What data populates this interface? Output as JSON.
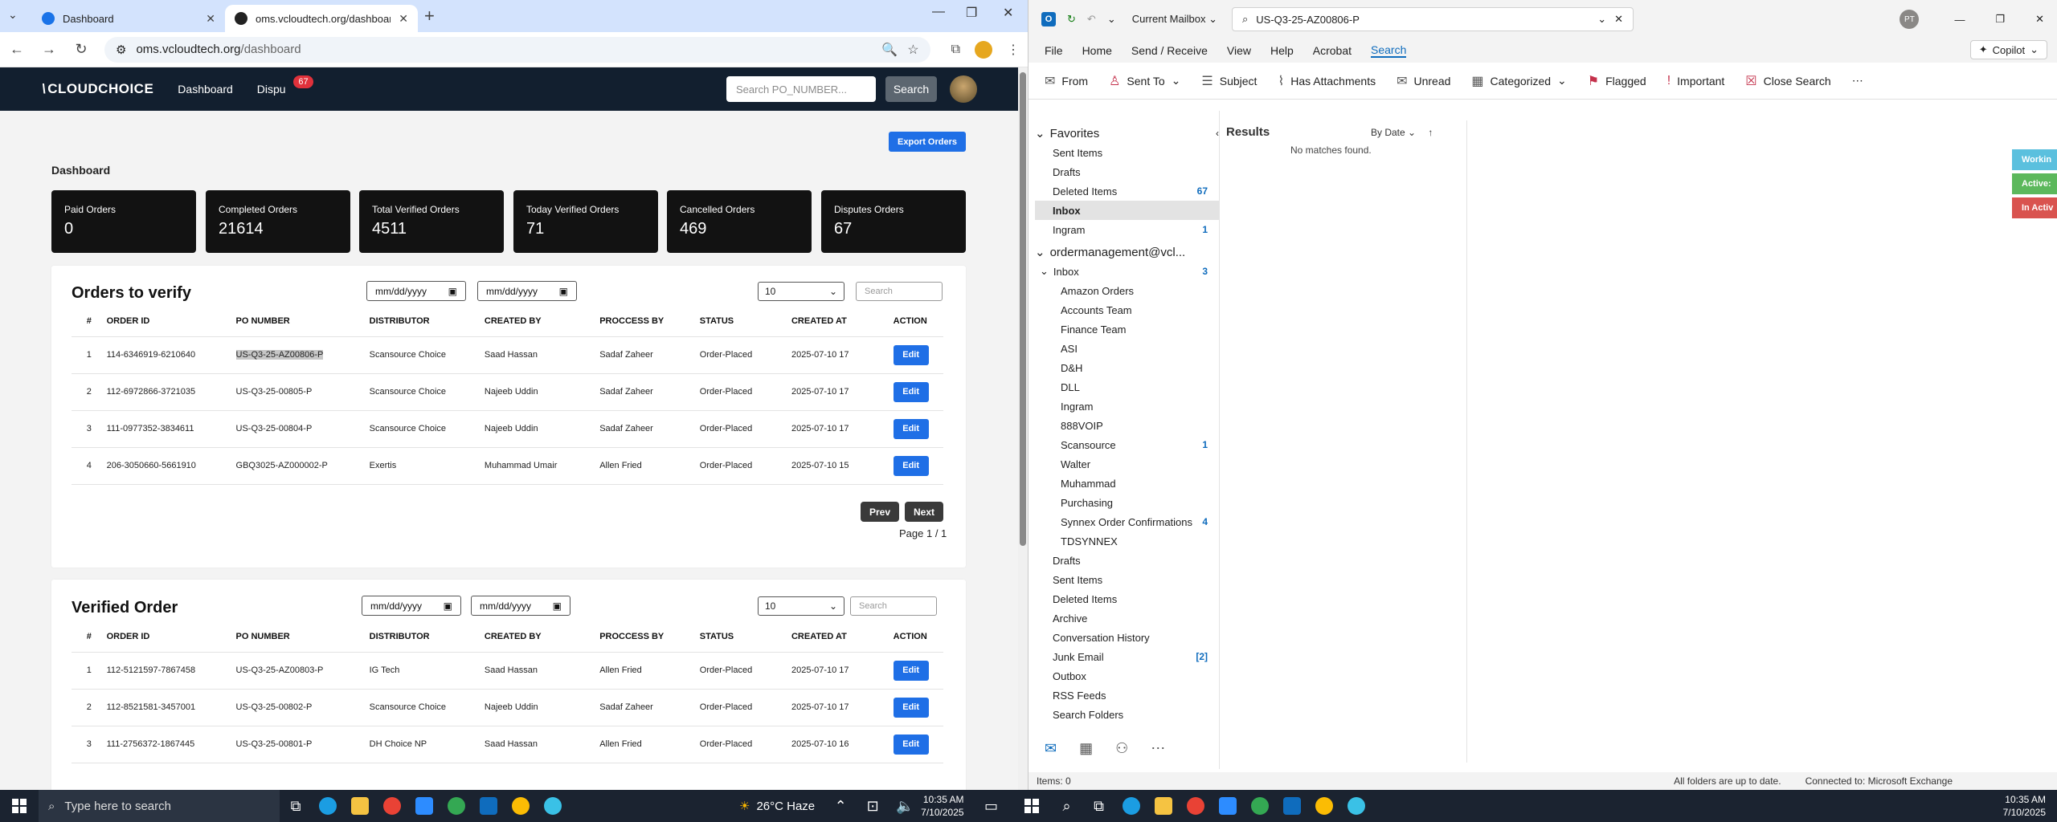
{
  "left_browser": {
    "tab_list_icon": "chevron-down-icon",
    "tabs": [
      {
        "title": "Dashboard",
        "active": false
      },
      {
        "title": "oms.vcloudtech.org/dashboard",
        "active": true
      }
    ],
    "address": {
      "host": "oms.vcloudtech.org",
      "path": "/dashboard"
    }
  },
  "app": {
    "logo_text": "CLOUDCHOICE",
    "nav": {
      "dashboard": "Dashboard",
      "disputes": "Dispu",
      "disputes_badge": "67"
    },
    "search_placeholder": "Search PO_NUMBER...",
    "search_button": "Search",
    "export_button": "Export Orders",
    "page_title": "Dashboard",
    "stats": [
      {
        "label": "Paid Orders",
        "value": "0"
      },
      {
        "label": "Completed Orders",
        "value": "21614"
      },
      {
        "label": "Total Verified Orders",
        "value": "4511"
      },
      {
        "label": "Today Verified Orders",
        "value": "71"
      },
      {
        "label": "Cancelled Orders",
        "value": "469"
      },
      {
        "label": "Disputes Orders",
        "value": "67"
      }
    ],
    "date_placeholder": "mm/dd/yyyy",
    "page_size": "10",
    "table_search_placeholder": "Search",
    "columns": [
      "#",
      "ORDER ID",
      "PO NUMBER",
      "DISTRIBUTOR",
      "CREATED BY",
      "PROCCESS BY",
      "STATUS",
      "CREATED AT",
      "ACTION"
    ],
    "edit_label": "Edit",
    "orders_to_verify": {
      "title": "Orders to verify",
      "rows": [
        [
          "1",
          "114-6346919-6210640",
          "US-Q3-25-AZ00806-P",
          "Scansource Choice",
          "Saad Hassan",
          "Sadaf Zaheer",
          "Order-Placed",
          "2025-07-10 17"
        ],
        [
          "2",
          "112-6972866-3721035",
          "US-Q3-25-00805-P",
          "Scansource Choice",
          "Najeeb Uddin",
          "Sadaf Zaheer",
          "Order-Placed",
          "2025-07-10 17"
        ],
        [
          "3",
          "111-0977352-3834611",
          "US-Q3-25-00804-P",
          "Scansource Choice",
          "Najeeb Uddin",
          "Sadaf Zaheer",
          "Order-Placed",
          "2025-07-10 17"
        ],
        [
          "4",
          "206-3050660-5661910",
          "GBQ3025-AZ000002-P",
          "Exertis",
          "Muhammad Umair",
          "Allen Fried",
          "Order-Placed",
          "2025-07-10 15"
        ]
      ],
      "prev": "Prev",
      "next": "Next",
      "page_info": "Page 1 / 1"
    },
    "verified_order": {
      "title": "Verified Order",
      "rows": [
        [
          "1",
          "112-5121597-7867458",
          "US-Q3-25-AZ00803-P",
          "IG Tech",
          "Saad Hassan",
          "Allen Fried",
          "Order-Placed",
          "2025-07-10 17"
        ],
        [
          "2",
          "112-8521581-3457001",
          "US-Q3-25-00802-P",
          "Scansource Choice",
          "Najeeb Uddin",
          "Sadaf Zaheer",
          "Order-Placed",
          "2025-07-10 17"
        ],
        [
          "3",
          "111-2756372-1867445",
          "US-Q3-25-00801-P",
          "DH Choice NP",
          "Saad Hassan",
          "Allen Fried",
          "Order-Placed",
          "2025-07-10 16"
        ]
      ]
    }
  },
  "outlook": {
    "scope": "Current Mailbox",
    "search_query": "US-Q3-25-AZ00806-P",
    "user_initials": "PT",
    "menu": [
      "File",
      "Home",
      "Send / Receive",
      "View",
      "Help",
      "Acrobat",
      "Search"
    ],
    "copilot": "Copilot",
    "ribbon": [
      {
        "label": "From",
        "icon": "envelope-icon"
      },
      {
        "label": "Sent To",
        "icon": "person-icon"
      },
      {
        "label": "Subject",
        "icon": "list-icon"
      },
      {
        "label": "Has Attachments",
        "icon": "paperclip-icon"
      },
      {
        "label": "Unread",
        "icon": "open-envelope-icon"
      },
      {
        "label": "Categorized",
        "icon": "category-icon"
      },
      {
        "label": "Flagged",
        "icon": "flag-icon"
      },
      {
        "label": "Important",
        "icon": "exclamation-icon"
      },
      {
        "label": "Close Search",
        "icon": "close-icon"
      }
    ],
    "favorites_label": "Favorites",
    "favorites": [
      {
        "name": "Sent Items",
        "count": ""
      },
      {
        "name": "Drafts",
        "count": ""
      },
      {
        "name": "Deleted Items",
        "count": "67"
      },
      {
        "name": "Inbox",
        "count": ""
      },
      {
        "name": "Ingram",
        "count": "1"
      }
    ],
    "account": "ordermanagement@vcl...",
    "inbox_label": "Inbox",
    "inbox_count": "3",
    "subfolders": [
      {
        "name": "Amazon Orders",
        "count": ""
      },
      {
        "name": "Accounts Team",
        "count": ""
      },
      {
        "name": "Finance Team",
        "count": ""
      },
      {
        "name": "ASI",
        "count": ""
      },
      {
        "name": "D&H",
        "count": ""
      },
      {
        "name": "DLL",
        "count": ""
      },
      {
        "name": "Ingram",
        "count": ""
      },
      {
        "name": "888VOIP",
        "count": ""
      },
      {
        "name": "Scansource",
        "count": "1"
      },
      {
        "name": "Walter",
        "count": ""
      },
      {
        "name": "Muhammad",
        "count": ""
      },
      {
        "name": "Purchasing",
        "count": ""
      },
      {
        "name": "Synnex Order Confirmations",
        "count": "4"
      },
      {
        "name": "TDSYNNEX",
        "count": ""
      }
    ],
    "other_folders": [
      {
        "name": "Drafts",
        "count": ""
      },
      {
        "name": "Sent Items",
        "count": ""
      },
      {
        "name": "Deleted Items",
        "count": ""
      },
      {
        "name": "Archive",
        "count": ""
      },
      {
        "name": "Conversation History",
        "count": ""
      },
      {
        "name": "Junk Email",
        "count": "[2]"
      },
      {
        "name": "Outbox",
        "count": ""
      },
      {
        "name": "RSS Feeds",
        "count": ""
      },
      {
        "name": "Search Folders",
        "count": ""
      }
    ],
    "results_title": "Results",
    "sort": "By Date",
    "no_matches": "No matches found.",
    "side_tags": [
      {
        "label": "Workin",
        "color": "#5bc0de"
      },
      {
        "label": "Active:",
        "color": "#5cb85c"
      },
      {
        "label": "In Activ",
        "color": "#d9534f"
      }
    ],
    "status": {
      "items": "Items: 0",
      "sync": "All folders are up to date.",
      "connection": "Connected to: Microsoft Exchange"
    }
  },
  "taskbar": {
    "search_placeholder": "Type here to search",
    "weather": "26°C  Haze",
    "time": "10:35 AM",
    "date": "7/10/2025"
  }
}
